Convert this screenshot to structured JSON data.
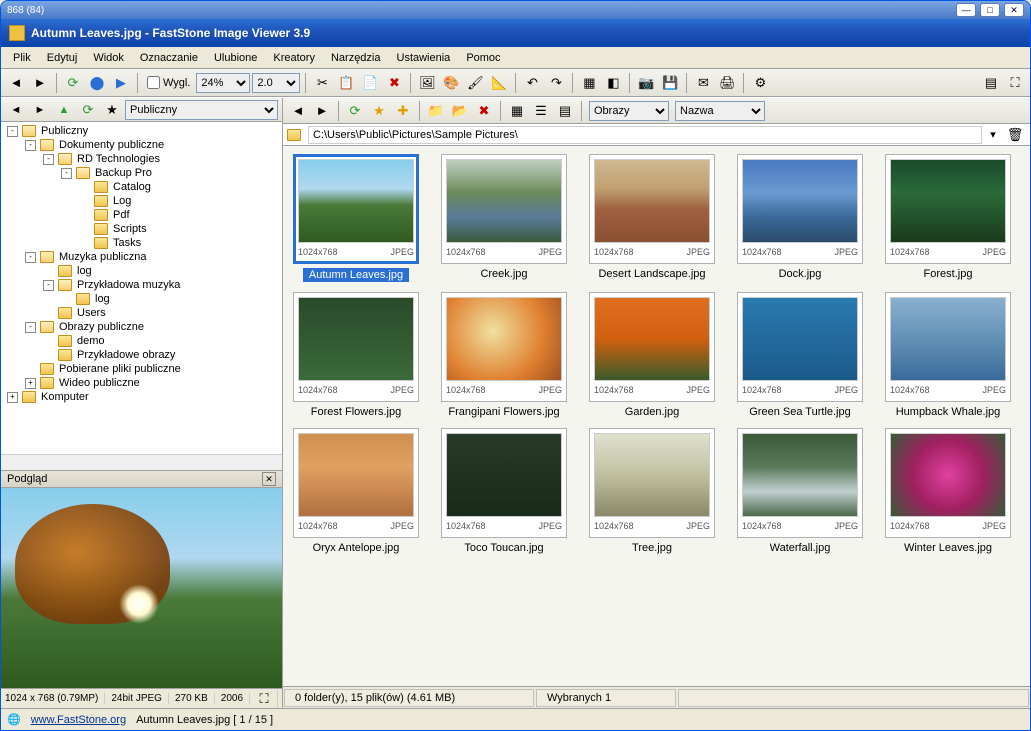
{
  "outer_title": "868 (84)",
  "window": {
    "title": "Autumn Leaves.jpg  -  FastStone Image Viewer 3.9"
  },
  "menu": [
    "Plik",
    "Edytuj",
    "Widok",
    "Oznaczanie",
    "Ulubione",
    "Kreatory",
    "Narzędzia",
    "Ustawienia",
    "Pomoc"
  ],
  "toolbar": {
    "wygl_label": "Wygl.",
    "zoom": "24%",
    "scale": "2.0"
  },
  "tree": {
    "root": "Publiczny",
    "nodes": [
      {
        "indent": 0,
        "toggle": "-",
        "icon": "folder-open",
        "label": "Publiczny"
      },
      {
        "indent": 1,
        "toggle": "-",
        "icon": "folder-open",
        "label": "Dokumenty publiczne"
      },
      {
        "indent": 2,
        "toggle": "-",
        "icon": "folder-open",
        "label": "RD Technologies"
      },
      {
        "indent": 3,
        "toggle": "-",
        "icon": "folder-open",
        "label": "Backup Pro"
      },
      {
        "indent": 4,
        "toggle": "",
        "icon": "folder",
        "label": "Catalog"
      },
      {
        "indent": 4,
        "toggle": "",
        "icon": "folder",
        "label": "Log"
      },
      {
        "indent": 4,
        "toggle": "",
        "icon": "folder",
        "label": "Pdf"
      },
      {
        "indent": 4,
        "toggle": "",
        "icon": "folder",
        "label": "Scripts"
      },
      {
        "indent": 4,
        "toggle": "",
        "icon": "folder",
        "label": "Tasks"
      },
      {
        "indent": 1,
        "toggle": "-",
        "icon": "folder-open",
        "label": "Muzyka publiczna"
      },
      {
        "indent": 2,
        "toggle": "",
        "icon": "folder",
        "label": "log"
      },
      {
        "indent": 2,
        "toggle": "-",
        "icon": "folder-open",
        "label": "Przykładowa muzyka"
      },
      {
        "indent": 3,
        "toggle": "",
        "icon": "folder",
        "label": "log"
      },
      {
        "indent": 2,
        "toggle": "",
        "icon": "folder",
        "label": "Users"
      },
      {
        "indent": 1,
        "toggle": "-",
        "icon": "folder-open",
        "label": "Obrazy publiczne"
      },
      {
        "indent": 2,
        "toggle": "",
        "icon": "folder",
        "label": "demo"
      },
      {
        "indent": 2,
        "toggle": "",
        "icon": "folder",
        "label": "Przykładowe obrazy"
      },
      {
        "indent": 1,
        "toggle": "",
        "icon": "folder",
        "label": "Pobierane pliki publiczne"
      },
      {
        "indent": 1,
        "toggle": "+",
        "icon": "folder",
        "label": "Wideo publiczne"
      },
      {
        "indent": 0,
        "toggle": "+",
        "icon": "computer",
        "label": "Komputer"
      }
    ]
  },
  "preview": {
    "title": "Podgląd",
    "status": {
      "dims": "1024 x 768 (0.79MP)",
      "depth": "24bit JPEG",
      "size": "270 KB",
      "year": "2006"
    }
  },
  "main_toolbar": {
    "sort1": "Obrazy",
    "sort2": "Nazwa"
  },
  "pathbar": {
    "path": "C:\\Users\\Public\\Pictures\\Sample Pictures\\"
  },
  "thumbs": [
    {
      "name": "Autumn Leaves.jpg",
      "dims": "1024x768",
      "fmt": "JPEG",
      "cls": "img-autumn",
      "selected": true
    },
    {
      "name": "Creek.jpg",
      "dims": "1024x768",
      "fmt": "JPEG",
      "cls": "img-creek"
    },
    {
      "name": "Desert Landscape.jpg",
      "dims": "1024x768",
      "fmt": "JPEG",
      "cls": "img-desert"
    },
    {
      "name": "Dock.jpg",
      "dims": "1024x768",
      "fmt": "JPEG",
      "cls": "img-dock"
    },
    {
      "name": "Forest.jpg",
      "dims": "1024x768",
      "fmt": "JPEG",
      "cls": "img-forest"
    },
    {
      "name": "Forest Flowers.jpg",
      "dims": "1024x768",
      "fmt": "JPEG",
      "cls": "img-fflowers"
    },
    {
      "name": "Frangipani Flowers.jpg",
      "dims": "1024x768",
      "fmt": "JPEG",
      "cls": "img-frangipani"
    },
    {
      "name": "Garden.jpg",
      "dims": "1024x768",
      "fmt": "JPEG",
      "cls": "img-garden"
    },
    {
      "name": "Green Sea Turtle.jpg",
      "dims": "1024x768",
      "fmt": "JPEG",
      "cls": "img-turtle"
    },
    {
      "name": "Humpback Whale.jpg",
      "dims": "1024x768",
      "fmt": "JPEG",
      "cls": "img-whale"
    },
    {
      "name": "Oryx Antelope.jpg",
      "dims": "1024x768",
      "fmt": "JPEG",
      "cls": "img-oryx"
    },
    {
      "name": "Toco Toucan.jpg",
      "dims": "1024x768",
      "fmt": "JPEG",
      "cls": "img-toucan"
    },
    {
      "name": "Tree.jpg",
      "dims": "1024x768",
      "fmt": "JPEG",
      "cls": "img-tree"
    },
    {
      "name": "Waterfall.jpg",
      "dims": "1024x768",
      "fmt": "JPEG",
      "cls": "img-waterfall"
    },
    {
      "name": "Winter Leaves.jpg",
      "dims": "1024x768",
      "fmt": "JPEG",
      "cls": "img-winter"
    }
  ],
  "status": {
    "folders": "0 folder(y), 15 plik(ów) (4.61 MB)",
    "selected": "Wybranych 1"
  },
  "footer": {
    "site": "www.FastStone.org",
    "current": "Autumn Leaves.jpg [ 1 / 15 ]"
  }
}
